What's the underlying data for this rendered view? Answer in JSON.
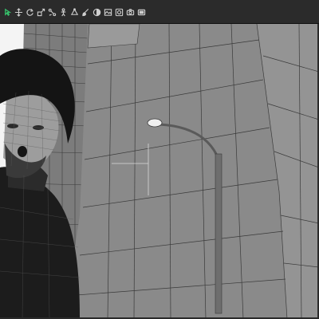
{
  "toolbar": {
    "tools": [
      {
        "icon": "universal-select-icon",
        "active": true
      },
      {
        "icon": "move-icon",
        "active": false
      },
      {
        "icon": "rotate-icon",
        "active": false
      },
      {
        "icon": "scale-icon",
        "active": false
      },
      {
        "icon": "joint-edit-icon",
        "active": false
      },
      {
        "icon": "figure-icon",
        "active": false
      },
      {
        "icon": "geometry-edit-icon",
        "active": false
      },
      {
        "icon": "surface-brush-icon",
        "active": false
      },
      {
        "icon": "node-weight-icon",
        "active": false
      },
      {
        "icon": "image-region-icon",
        "active": false
      },
      {
        "icon": "render-icon",
        "active": false
      },
      {
        "icon": "camera-icon",
        "active": false
      },
      {
        "icon": "camera-preview-icon",
        "active": false
      }
    ],
    "active_color": "#36c06a"
  },
  "viewport": {
    "draw_style": "wireframe-shaded",
    "colors": {
      "background": "#f4f4f4",
      "building": "#8a8a8a",
      "wire": "#3a3a3a",
      "figure": "#1c1c1c"
    }
  }
}
